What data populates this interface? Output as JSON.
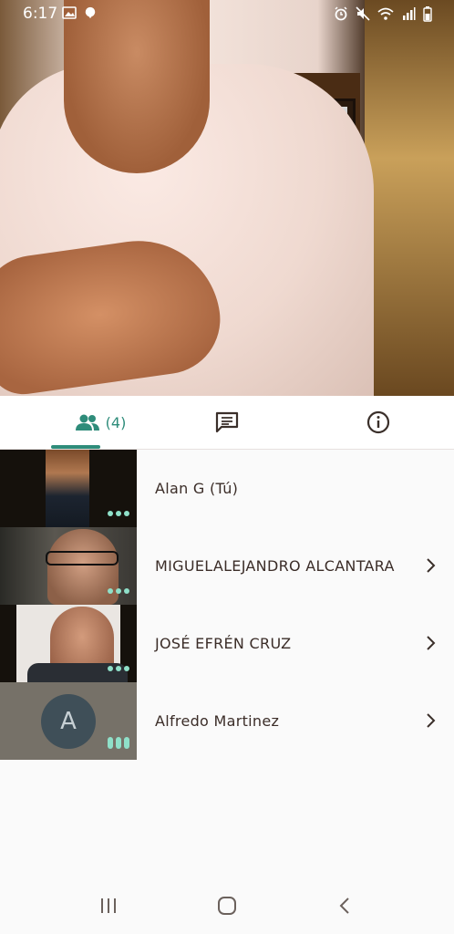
{
  "status_bar": {
    "time": "6:17",
    "left_icons": [
      "image-icon",
      "location-icon"
    ],
    "right_icons": [
      "alarm-icon",
      "mute-icon",
      "wifi-icon",
      "signal-icon",
      "battery-icon"
    ]
  },
  "tabs": {
    "people_count": "(4)",
    "items": [
      "people-icon",
      "chat-icon",
      "info-icon"
    ],
    "accent_color": "#2e8c7a"
  },
  "participants": [
    {
      "name": "Alan G (Tú)",
      "has_chevron": false
    },
    {
      "name": "MIGUELALEJANDRO ALCANTARA",
      "has_chevron": true
    },
    {
      "name": "JOSÉ EFRÉN CRUZ",
      "has_chevron": true
    },
    {
      "name": "Alfredo Martinez",
      "has_chevron": true,
      "avatar_letter": "A"
    }
  ],
  "nav_bar": [
    "recents-icon",
    "home-icon",
    "back-icon"
  ]
}
